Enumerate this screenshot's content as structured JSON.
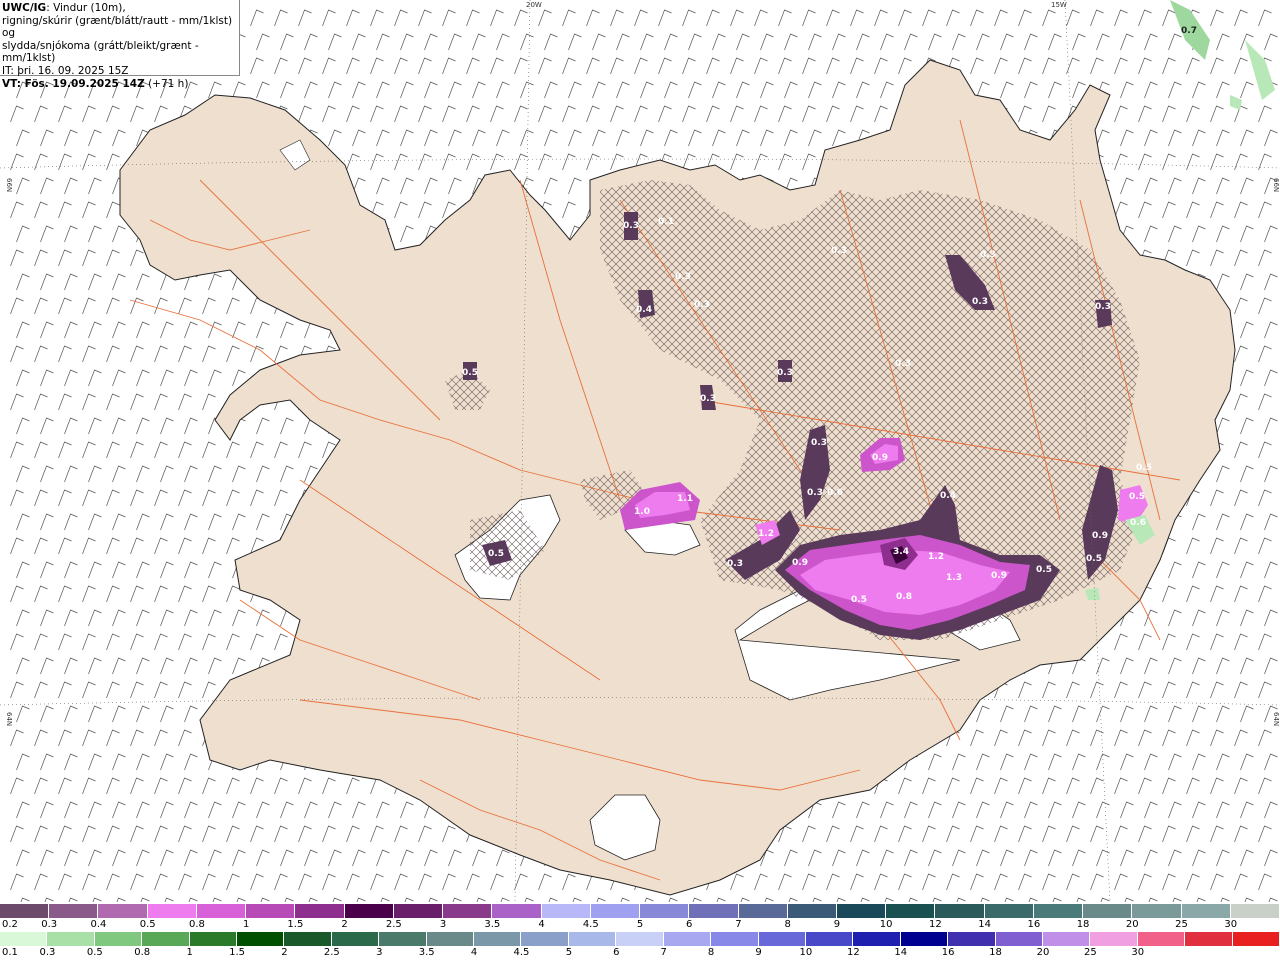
{
  "header": {
    "model": "UWC/IG",
    "line1_rest": ": Vindur (10m),",
    "line2": "rigning/skúrir (grænt/blátt/rautt - mm/1klst) og",
    "line3": "slydda/snjókoma (grátt/bleikt/grænt - mm/1klst)",
    "line4": "IT: þri. 16. 09. 2025 15Z",
    "line5_bold": "VT: Fös. 19.09.2025 14Z",
    "line5_rest": " (+71 h)"
  },
  "grid_labels": {
    "lon_20w": "20W",
    "lon_15w": "15W",
    "lat_66n_left": "66N",
    "lat_66n_right": "66N",
    "lat_64n_left": "64N",
    "lat_64n_right": "64N"
  },
  "map_labels": [
    {
      "text": "0.7"
    },
    {
      "text": "0.3"
    },
    {
      "text": "0.1"
    },
    {
      "text": "0.3"
    },
    {
      "text": "0.4"
    },
    {
      "text": "0.3"
    },
    {
      "text": "0.3"
    },
    {
      "text": "0.3"
    },
    {
      "text": "0.3"
    },
    {
      "text": "0.3"
    },
    {
      "text": "0.3"
    },
    {
      "text": "0.3"
    },
    {
      "text": "0.3"
    },
    {
      "text": "0.5"
    },
    {
      "text": "0.3"
    },
    {
      "text": "0.9"
    },
    {
      "text": "0.3"
    },
    {
      "text": "0.6"
    },
    {
      "text": "0.4"
    },
    {
      "text": "1.0"
    },
    {
      "text": "1.1"
    },
    {
      "text": "0.5"
    },
    {
      "text": "1.2"
    },
    {
      "text": "0.3"
    },
    {
      "text": "0.9"
    },
    {
      "text": "3.4"
    },
    {
      "text": "1.2"
    },
    {
      "text": "1.3"
    },
    {
      "text": "0.9"
    },
    {
      "text": "0.5"
    },
    {
      "text": "0.5"
    },
    {
      "text": "0.8"
    },
    {
      "text": "0.5"
    },
    {
      "text": "0.9"
    },
    {
      "text": "0.6"
    },
    {
      "text": "0.5"
    },
    {
      "text": "0.5"
    }
  ],
  "legend_snow": {
    "colors": [
      "#6b4a6b",
      "#8a5a8a",
      "#b06ab0",
      "#ee7cee",
      "#d860d8",
      "#b84ab8",
      "#8e2e8e",
      "#4a004a",
      "#6a1f6a",
      "#8a3a8a",
      "#aa62c8",
      "#b8b8f8",
      "#a0a0f0",
      "#8888d8",
      "#7070b8",
      "#5a6a98",
      "#3a5a78",
      "#1a4a5a",
      "#1a5050",
      "#2a5a5a",
      "#3a6a6a",
      "#4a7a7a",
      "#6a8a8a",
      "#7a9a9a",
      "#8aa8a8",
      "#c8d0c8"
    ],
    "labels": [
      "0.2",
      "0.3",
      "0.4",
      "0.5",
      "0.8",
      "1",
      "1.5",
      "2",
      "2.5",
      "3",
      "3.5",
      "4",
      "4.5",
      "5",
      "6",
      "7",
      "8",
      "9",
      "10",
      "12",
      "14",
      "16",
      "18",
      "20",
      "25",
      "30"
    ]
  },
  "legend_rain": {
    "colors": [
      "#d8f8d8",
      "#a8e0a8",
      "#80c880",
      "#58a858",
      "#2a7a2a",
      "#005000",
      "#1a5a2a",
      "#2a6a4a",
      "#4a7a6a",
      "#6a8a8a",
      "#7a98a8",
      "#8aa0c8",
      "#a8b8e8",
      "#c8d0f8",
      "#a8a8f0",
      "#8888e8",
      "#6868d8",
      "#4848c8",
      "#2020b0",
      "#000090",
      "#4030b0",
      "#8060d0",
      "#c090e8",
      "#f0a0e0",
      "#f06088",
      "#e03040",
      "#e82020"
    ],
    "labels": [
      "0.1",
      "0.3",
      "0.5",
      "0.8",
      "1",
      "1.5",
      "2",
      "2.5",
      "3",
      "3.5",
      "4",
      "4.5",
      "5",
      "6",
      "7",
      "8",
      "9",
      "10",
      "12",
      "14",
      "16",
      "18",
      "20",
      "25",
      "30"
    ]
  }
}
